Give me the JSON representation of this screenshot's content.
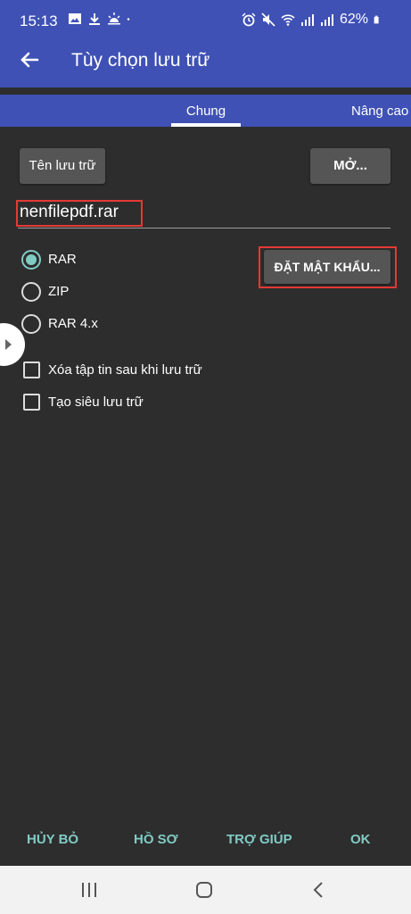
{
  "status": {
    "time": "15:13",
    "battery": "62%"
  },
  "appbar": {
    "title": "Tùy chọn lưu trữ"
  },
  "tabs": [
    {
      "label": "Chung"
    },
    {
      "label": "Nâng cao"
    }
  ],
  "general": {
    "archive_name_button": "Tên lưu trữ",
    "open_button": "MỞ...",
    "archive_name_value": "nenfilepdf.rar",
    "set_password_button": "ĐẶT MẬT KHẨU...",
    "formats": [
      {
        "label": "RAR",
        "selected": true
      },
      {
        "label": "ZIP",
        "selected": false
      },
      {
        "label": "RAR 4.x",
        "selected": false
      }
    ],
    "options": [
      {
        "label": "Xóa tập tin sau khi lưu trữ",
        "checked": false
      },
      {
        "label": "Tạo siêu lưu trữ",
        "checked": false
      }
    ]
  },
  "footer": {
    "cancel": "HỦY BỎ",
    "profile": "HỒ SƠ",
    "help": "TRỢ GIÚP",
    "ok": "OK"
  },
  "colors": {
    "primary": "#3f51b5",
    "accent": "#80cbc4",
    "background": "#2d2d2d",
    "button": "#555555",
    "highlight": "#e53935"
  }
}
